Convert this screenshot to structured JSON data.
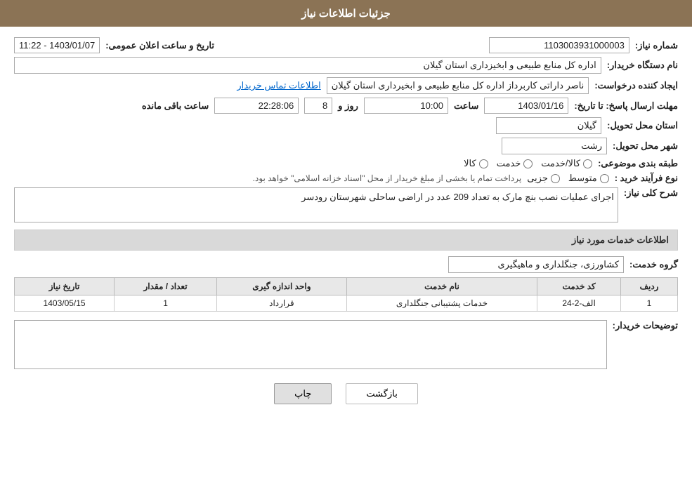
{
  "header": {
    "title": "جزئیات اطلاعات نیاز"
  },
  "fields": {
    "need_number_label": "شماره نیاز:",
    "need_number_value": "1103003931000003",
    "buyer_org_label": "نام دستگاه خریدار:",
    "buyer_org_value": "اداره کل منابع طبیعی و ابخیزداری استان گیلان",
    "creator_label": "ایجاد کننده درخواست:",
    "creator_value": "ناصر  داراتی کاربرداز اداره کل منابع طبیعی و ابخیرداری استان گیلان",
    "creator_link": "اطلاعات تماس خریدار",
    "announce_date_label": "تاریخ و ساعت اعلان عمومی:",
    "announce_date_value": "1403/01/07 - 11:22",
    "response_deadline_label": "مهلت ارسال پاسخ: تا تاریخ:",
    "response_date": "1403/01/16",
    "response_time_label": "ساعت",
    "response_time": "10:00",
    "response_days_label": "روز و",
    "response_days": "8",
    "response_remaining_label": "ساعت باقی مانده",
    "response_remaining": "22:28:06",
    "province_label": "استان محل تحویل:",
    "province_value": "گیلان",
    "city_label": "شهر محل تحویل:",
    "city_value": "رشت",
    "category_label": "طبقه بندی موضوعی:",
    "category_options": [
      {
        "label": "کالا",
        "selected": false
      },
      {
        "label": "خدمت",
        "selected": false
      },
      {
        "label": "کالا/خدمت",
        "selected": false
      }
    ],
    "purchase_type_label": "نوع فرآیند خرید :",
    "purchase_type_options": [
      {
        "label": "جزیی",
        "selected": false
      },
      {
        "label": "متوسط",
        "selected": false
      }
    ],
    "purchase_type_note": "پرداخت تمام یا بخشی از مبلغ خریدار از محل \"اسناد خزانه اسلامی\" خواهد بود.",
    "description_label": "شرح کلی نیاز:",
    "description_value": "اجرای عملیات نصب بنچ مارک به تعداد 209 عدد در اراضی ساحلی شهرستان رودسر",
    "services_section_title": "اطلاعات خدمات مورد نیاز",
    "service_group_label": "گروه خدمت:",
    "service_group_value": "کشاورزی، جنگلداری و ماهیگیری",
    "table": {
      "headers": [
        "ردیف",
        "کد خدمت",
        "نام خدمت",
        "واحد اندازه گیری",
        "تعداد / مقدار",
        "تاریخ نیاز"
      ],
      "rows": [
        {
          "row_num": "1",
          "service_code": "الف-2-24",
          "service_name": "خدمات پشتیبانی جنگلداری",
          "unit": "قرارداد",
          "quantity": "1",
          "date": "1403/05/15"
        }
      ]
    },
    "buyer_notes_label": "توضیحات خریدار:",
    "buyer_notes_value": ""
  },
  "buttons": {
    "print_label": "چاپ",
    "back_label": "بازگشت"
  }
}
